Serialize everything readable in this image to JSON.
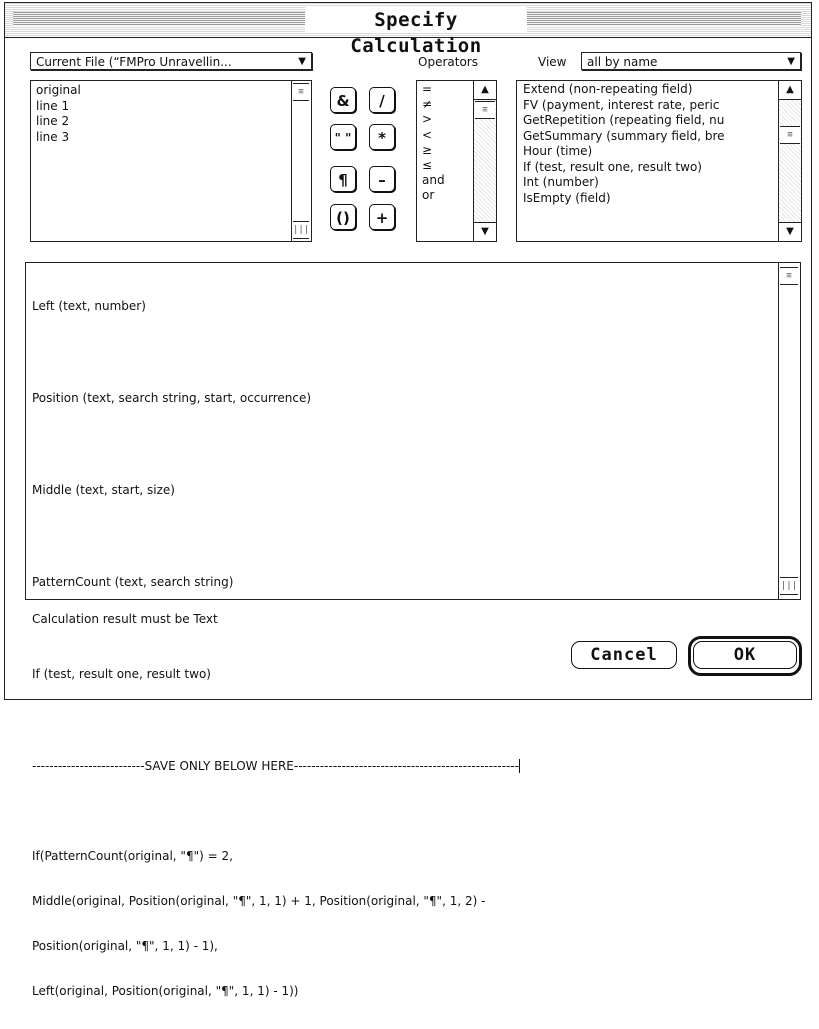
{
  "dialog": {
    "title": "Specify Calculation"
  },
  "fields": {
    "file_popup": "Current File (“FMPro Unravellin...",
    "items": [
      "original",
      "line 1",
      "line 2",
      "line 3"
    ]
  },
  "operator_buttons": [
    "&",
    "/",
    "\" \"",
    "*",
    "¶",
    "–",
    "()",
    "+"
  ],
  "operators": {
    "label": "Operators",
    "items": [
      "=",
      "≠",
      ">",
      "<",
      "≥",
      "≤",
      "and",
      "or"
    ]
  },
  "view": {
    "label": "View",
    "selected": "all by name",
    "functions": [
      "Extend (non-repeating field)",
      "FV (payment, interest rate, peric",
      "GetRepetition (repeating field, nu",
      "GetSummary (summary field, bre",
      "Hour (time)",
      "If (test, result one, result two)",
      "Int (number)",
      "IsEmpty (field)"
    ]
  },
  "formula": {
    "lines": [
      "Left (text, number)",
      "Position (text, search string, start, occurrence)",
      "Middle (text, start, size)",
      "PatternCount (text, search string)",
      "If (test, result one, result two)"
    ],
    "separator_left": "--------------------------",
    "separator_text": "SAVE ONLY BELOW HERE",
    "separator_right": "----------------------------------------------------",
    "code": [
      "If(PatternCount(original, \"¶\") = 2,",
      "Middle(original, Position(original, \"¶\", 1, 1) + 1, Position(original, \"¶\", 1, 2) -",
      "Position(original, \"¶\", 1, 1) - 1),",
      "Left(original, Position(original, \"¶\", 1, 1) - 1))"
    ]
  },
  "result_label": "Calculation result must be Text",
  "buttons": {
    "cancel": "Cancel",
    "ok": "OK"
  },
  "icons": {
    "popup_arrow": "triangle-down-icon",
    "scroll_up": "triangle-up-icon",
    "scroll_down": "triangle-down-icon"
  }
}
